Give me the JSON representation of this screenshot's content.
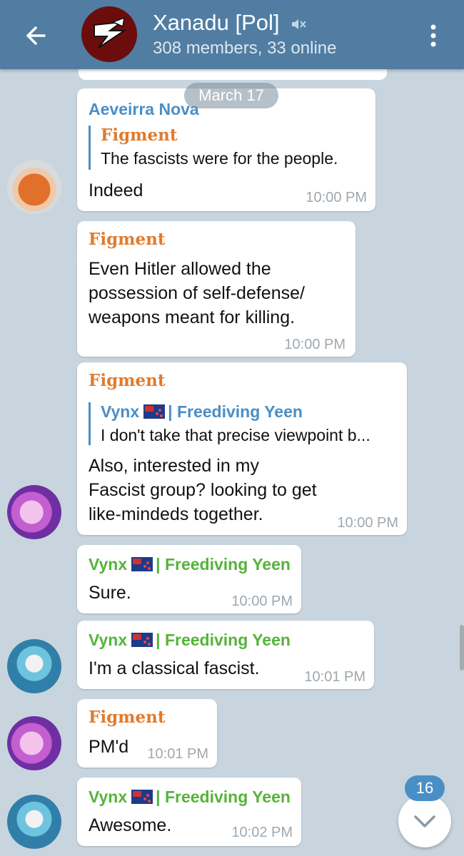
{
  "header": {
    "title": "Xanadu [Pol]",
    "subtitle": "308 members, 33 online"
  },
  "date_separator": "March 17",
  "messages": [
    {
      "sender": "Aeveirra Nova",
      "reply_to": {
        "name": "Figment",
        "text": "The fascists were for the people."
      },
      "text": "Indeed",
      "time": "10:00 PM"
    },
    {
      "sender": "Figment",
      "lines": [
        "Even Hitler allowed the",
        "possession of self-defense/",
        "weapons meant for killing."
      ],
      "time": "10:00 PM"
    },
    {
      "sender": "Figment",
      "reply_to": {
        "name_prefix": "Vynx",
        "name_suffix": "| Freediving Yeen",
        "text": "I don't take that precise viewpoint b..."
      },
      "lines": [
        "Also, interested in my",
        "Fascist group? looking to get",
        "like-mindeds together."
      ],
      "time": "10:00 PM"
    },
    {
      "sender_prefix": "Vynx",
      "sender_suffix": "| Freediving Yeen",
      "text": "Sure.",
      "time": "10:00 PM"
    },
    {
      "sender_prefix": "Vynx",
      "sender_suffix": "| Freediving Yeen",
      "text": "I'm a classical fascist.",
      "time": "10:01 PM"
    },
    {
      "sender": "Figment",
      "text": "PM'd",
      "time": "10:01 PM"
    },
    {
      "sender_prefix": "Vynx",
      "sender_suffix": "| Freediving Yeen",
      "text": "Awesome.",
      "time": "10:02 PM"
    }
  ],
  "unread_badge": "16",
  "colors": {
    "header": "#517da2",
    "blue_name": "#4a8ec6",
    "orange_name": "#e07b2e",
    "green_name": "#56b33a"
  }
}
